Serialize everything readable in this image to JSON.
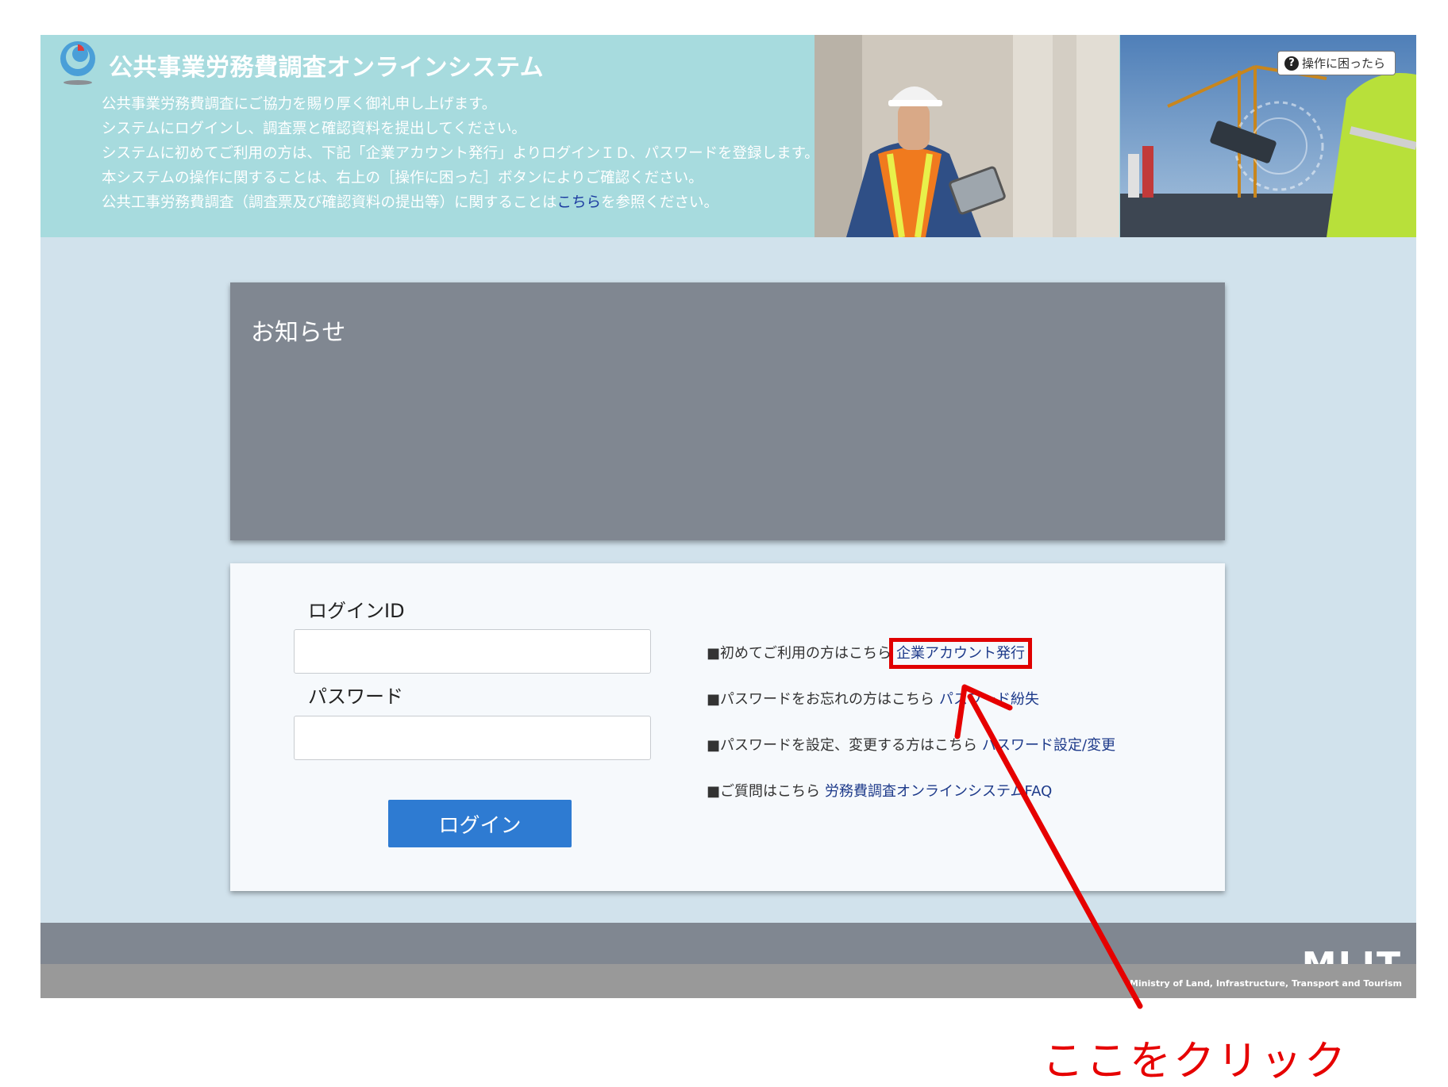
{
  "header": {
    "app_title": "公共事業労務費調査オンラインシステム",
    "intro_lines": [
      "公共事業労務費調査にご協力を賜り厚く御礼申し上げます。",
      "システムにログインし、調査票と確認資料を提出してください。",
      "システムに初めてご利用の方は、下記「企業アカウント発行」よりログインＩＤ、パスワードを登録します。",
      "本システムの操作に関することは、右上の［操作に困った］ボタンによりご確認ください。"
    ],
    "intro_last_prefix": "公共工事労務費調査（調査票及び確認資料の提出等）に関することは",
    "intro_last_link": "こちら",
    "intro_last_suffix": "を参照ください。",
    "help_icon": "?",
    "help_button_label": "操作に困ったら"
  },
  "notice": {
    "title": "お知らせ"
  },
  "login": {
    "id_label": "ログインID",
    "id_value": "",
    "password_label": "パスワード",
    "password_value": "",
    "button_label": "ログイン",
    "links": [
      {
        "prefix": "■初めてご利用の方はこちら",
        "link": "企業アカウント発行"
      },
      {
        "prefix": "■パスワードをお忘れの方はこちら",
        "link": "パスワード紛失"
      },
      {
        "prefix": "■パスワードを設定、変更する方はこちら",
        "link": "パスワード設定/変更"
      },
      {
        "prefix": "■ご質問はこちら",
        "link": "労務費調査オンラインシステムFAQ"
      }
    ]
  },
  "footer": {
    "logo_text": "MLIT",
    "logo_subtitle": "Ministry of Land, Infrastructure, Transport and Tourism"
  },
  "annotation": {
    "text": "ここをクリック",
    "color": "#e60000"
  },
  "icons": {
    "logo": "mlit-emblem-icon",
    "help": "question-circle-icon"
  },
  "colors": {
    "header_bg": "#a7dbde",
    "page_bg": "#d1e2ec",
    "notice_bg": "#808791",
    "login_button": "#2e7bd2"
  }
}
